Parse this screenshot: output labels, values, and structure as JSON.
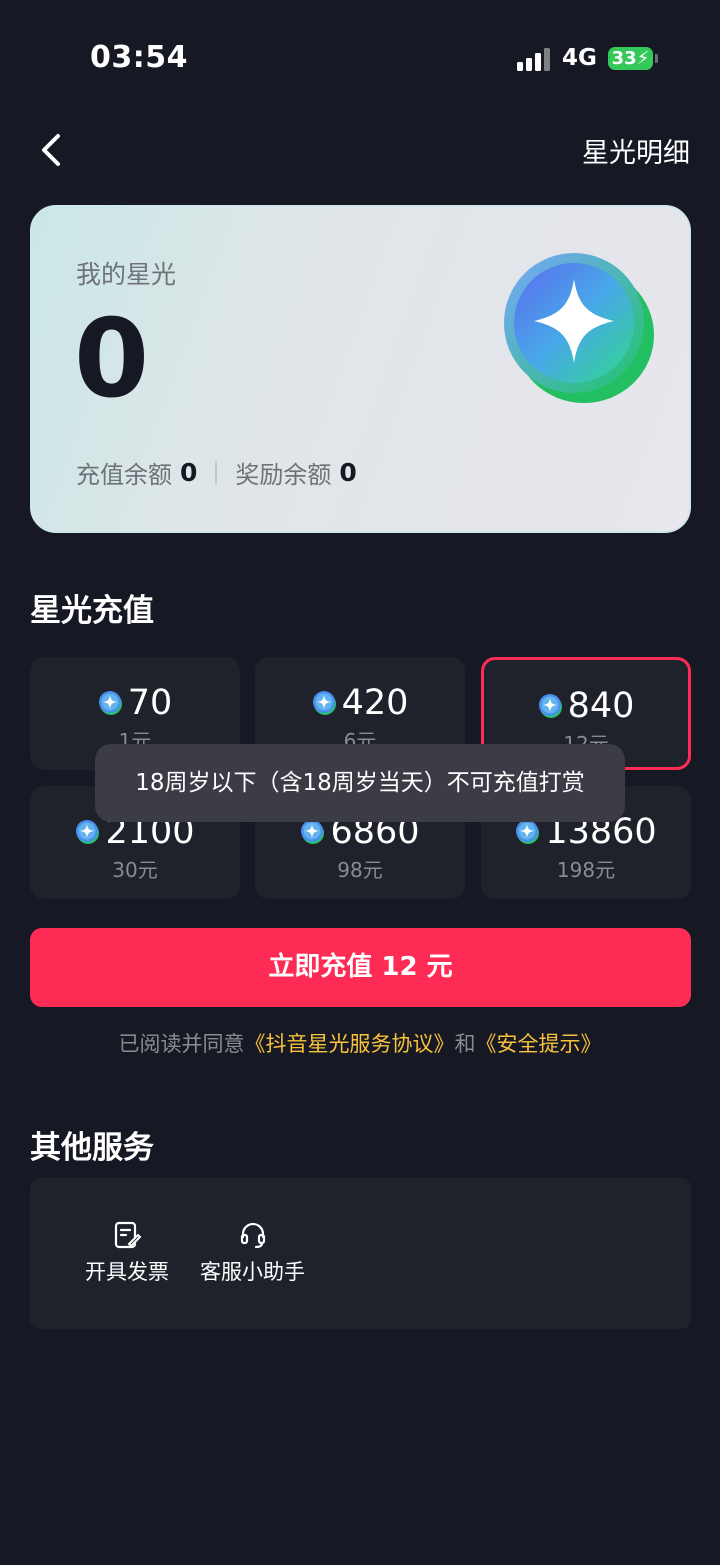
{
  "status_bar": {
    "time": "03:54",
    "network": "4G",
    "battery": "33"
  },
  "nav": {
    "detail_link": "星光明细"
  },
  "balance": {
    "label": "我的星光",
    "amount": "0",
    "recharge_label": "充值余额",
    "recharge_value": "0",
    "reward_label": "奖励余额",
    "reward_value": "0"
  },
  "recharge": {
    "title": "星光充值",
    "packages": [
      {
        "amount": "70",
        "price": "1元"
      },
      {
        "amount": "420",
        "price": "6元"
      },
      {
        "amount": "840",
        "price": "12元",
        "selected": true
      },
      {
        "amount": "2100",
        "price": "30元"
      },
      {
        "amount": "6860",
        "price": "98元"
      },
      {
        "amount": "13860",
        "price": "198元"
      }
    ],
    "toast": "18周岁以下（含18周岁当天）不可充值打赏",
    "pay_button": "立即充值 12 元",
    "agreement_prefix": "已阅读并同意",
    "agreement_link1": "《抖音星光服务协议》",
    "agreement_and": "和",
    "agreement_link2": "《安全提示》"
  },
  "services": {
    "title": "其他服务",
    "items": [
      {
        "label": "开具发票",
        "icon": "invoice-icon"
      },
      {
        "label": "客服小助手",
        "icon": "headset-icon"
      }
    ]
  },
  "colors": {
    "accent": "#fe2c55",
    "link": "#f9c23c",
    "background": "#161823"
  }
}
